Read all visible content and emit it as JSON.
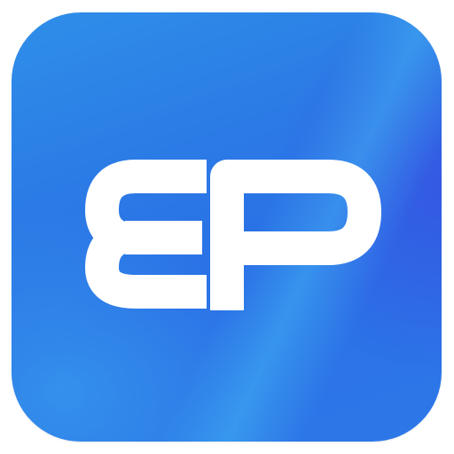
{
  "logo": {
    "lettering": "EP",
    "icon": "ep-monogram-icon",
    "colors": {
      "background_primary": "#2b7ae6",
      "background_highlight": "#3aa6ef",
      "background_deep": "#3b48e0",
      "glyph": "#ffffff",
      "page": "#ffffff"
    }
  }
}
